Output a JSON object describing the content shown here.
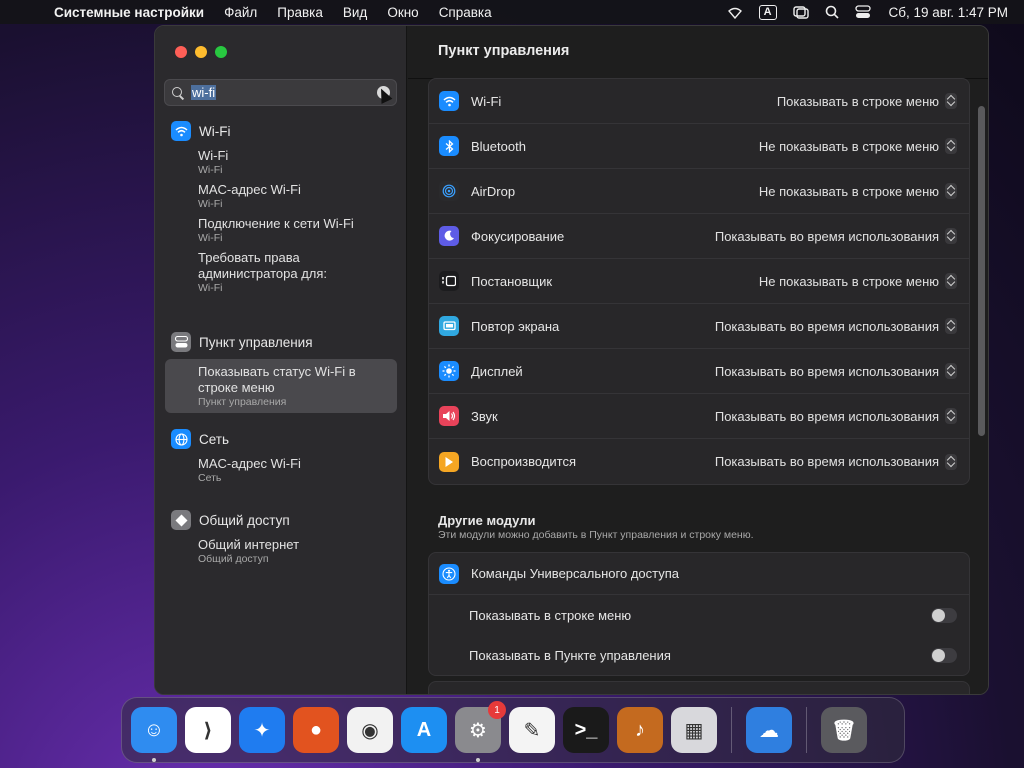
{
  "menubar": {
    "app": "Системные настройки",
    "items": [
      "Файл",
      "Правка",
      "Вид",
      "Окно",
      "Справка"
    ],
    "keyboard_indicator": "A",
    "clock": "Сб, 19 авг. 1:47 PM"
  },
  "search": {
    "value": "wi-fi"
  },
  "sidebar": {
    "sections": [
      {
        "title": "Wi-Fi",
        "icon": "wifi-icon",
        "color": "#1a8cff",
        "items": [
          {
            "title": "Wi-Fi",
            "subtitle": "Wi-Fi"
          },
          {
            "title": "MAC-адрес Wi-Fi",
            "subtitle": "Wi-Fi"
          },
          {
            "title": "Подключение к сети Wi-Fi",
            "subtitle": "Wi-Fi"
          },
          {
            "title": "Требовать права администратора для:",
            "subtitle": "Wi-Fi"
          }
        ]
      },
      {
        "title": "Пункт управления",
        "icon": "control-center-icon",
        "color": "#7a7a7e",
        "items": [
          {
            "title": "Показывать статус Wi-Fi в строке меню",
            "subtitle": "Пункт управления",
            "selected": true
          }
        ]
      },
      {
        "title": "Сеть",
        "icon": "globe-icon",
        "color": "#1a8cff",
        "items": [
          {
            "title": "MAC-адрес Wi-Fi",
            "subtitle": "Сеть"
          }
        ]
      },
      {
        "title": "Общий доступ",
        "icon": "sharing-icon",
        "color": "#7a7a7e",
        "items": [
          {
            "title": "Общий интернет",
            "subtitle": "Общий доступ"
          }
        ]
      }
    ]
  },
  "main": {
    "title": "Пункт управления",
    "modules": [
      {
        "label": "Wi-Fi",
        "value": "Показывать в строке меню",
        "icon": "wifi-icon",
        "color": "#1a8cff"
      },
      {
        "label": "Bluetooth",
        "value": "Не показывать в строке меню",
        "icon": "bluetooth-icon",
        "color": "#1a8cff"
      },
      {
        "label": "AirDrop",
        "value": "Не показывать в строке меню",
        "icon": "airdrop-icon",
        "color": "#2a2a2c"
      },
      {
        "label": "Фокусирование",
        "value": "Показывать во время использования",
        "icon": "moon-icon",
        "color": "#5e5ce6"
      },
      {
        "label": "Постановщик",
        "value": "Не показывать в строке меню",
        "icon": "stage-manager-icon",
        "color": "#1c1c1e"
      },
      {
        "label": "Повтор экрана",
        "value": "Показывать во время использования",
        "icon": "screen-mirroring-icon",
        "color": "#30a8e0"
      },
      {
        "label": "Дисплей",
        "value": "Показывать во время использования",
        "icon": "sun-icon",
        "color": "#1a8cff"
      },
      {
        "label": "Звук",
        "value": "Показывать во время использования",
        "icon": "speaker-icon",
        "color": "#e8435a"
      },
      {
        "label": "Воспроизводится",
        "value": "Показывать во время использования",
        "icon": "play-icon",
        "color": "#f5a623"
      }
    ],
    "other": {
      "title": "Другие модули",
      "subtitle": "Эти модули можно добавить в Пункт управления и строку меню.",
      "module_label": "Команды Универсального доступа",
      "menu_bar_label": "Показывать в строке меню",
      "control_center_label": "Показывать в Пункте управления"
    }
  },
  "dock": {
    "apps": [
      {
        "name": "finder-icon",
        "color": "#2f8cf0",
        "glyph": "☺",
        "running": true
      },
      {
        "name": "vscode-icon",
        "color": "#ffffff",
        "glyph": "⟩",
        "running": false
      },
      {
        "name": "safari-icon",
        "color": "#1f7cf0",
        "glyph": "✦",
        "running": false
      },
      {
        "name": "firefox-icon",
        "color": "#e2531f",
        "glyph": "●",
        "running": false
      },
      {
        "name": "chrome-icon",
        "color": "#f2f2f2",
        "glyph": "◉",
        "running": false
      },
      {
        "name": "app-store-icon",
        "color": "#1d8ff2",
        "glyph": "A",
        "running": false
      },
      {
        "name": "system-settings-icon",
        "color": "#8a8a8e",
        "glyph": "⚙",
        "running": true,
        "badge": "1"
      },
      {
        "name": "textedit-icon",
        "color": "#f4f4f4",
        "glyph": "✎",
        "running": false
      },
      {
        "name": "terminal-icon",
        "color": "#1a1a1a",
        "glyph": ">_",
        "running": false
      },
      {
        "name": "garageband-icon",
        "color": "#c46a1f",
        "glyph": "♪",
        "running": false
      },
      {
        "name": "launchpad-icon",
        "color": "#d8d8dc",
        "glyph": "▦",
        "running": false
      },
      {
        "name": "weather-icon",
        "color": "#2f7fe0",
        "glyph": "☁",
        "running": false
      },
      {
        "name": "trash-icon",
        "color": "#5a5a5e",
        "glyph": "🗑",
        "running": false
      }
    ]
  }
}
